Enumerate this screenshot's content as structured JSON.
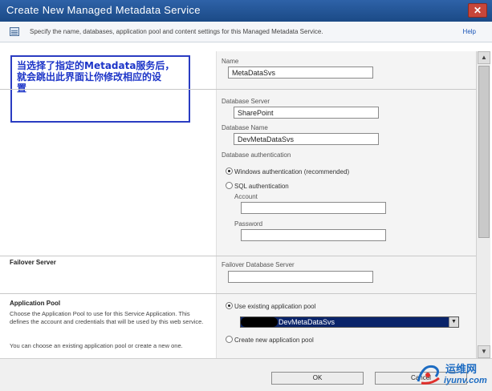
{
  "window": {
    "title": "Create New Managed Metadata Service",
    "close_glyph": "✕"
  },
  "description_bar": {
    "text": "Specify the name, databases, application pool and content settings for this Managed Metadata Service.",
    "help_label": "Help"
  },
  "annotation": {
    "lines": [
      "当选择了指定的Metadata服务后，",
      "就会跳出此界面让你修改相应的设",
      "置"
    ],
    "border_color": "#2a3cc2",
    "text_color": "#1d35c8"
  },
  "name_section": {
    "label": "Name",
    "value": "MetaDataSvs"
  },
  "database_section": {
    "server_label": "Database Server",
    "server_value": "SharePoint",
    "name_label": "Database Name",
    "name_value": "DevMetaDataSvs",
    "auth_label": "Database authentication",
    "windows_auth_label": "Windows authentication (recommended)",
    "sql_auth_label": "SQL authentication",
    "account_label": "Account",
    "account_value": "",
    "password_label": "Password",
    "password_value": "",
    "selected_auth": "windows"
  },
  "failover_section": {
    "heading": "Failover Server",
    "label": "Failover Database Server",
    "value": ""
  },
  "app_pool_section": {
    "heading": "Application Pool",
    "description": "Choose the Application Pool to use for this Service Application. This defines the account and credentials that will be used by this web service.",
    "description_2": "You can choose an existing application pool or create a new one.",
    "use_existing_label": "Use existing application pool",
    "selected_pool": "DevMetaDataSvs",
    "create_new_label": "Create new application pool",
    "selected_option": "existing"
  },
  "footer": {
    "ok_label": "OK",
    "cancel_label": "Cancel"
  },
  "watermark": {
    "brand": "运维网",
    "domain": "iyunv.com"
  },
  "colors": {
    "title_bar": "#1f4e89",
    "link": "#1a56b8",
    "selection": "#0a246a"
  }
}
